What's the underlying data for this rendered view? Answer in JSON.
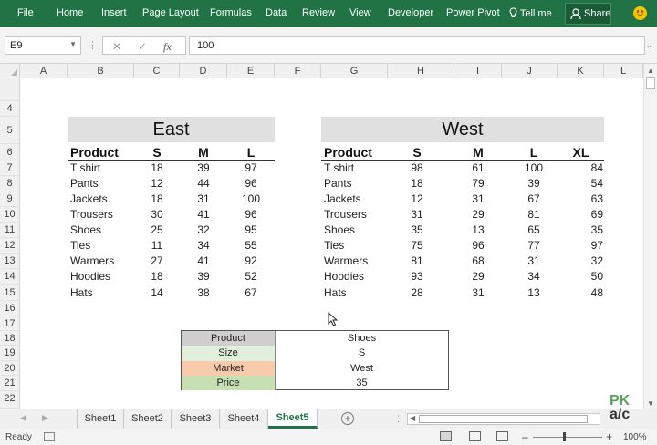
{
  "ribbon": {
    "tabs": [
      "File",
      "Home",
      "Insert",
      "Page Layout",
      "Formulas",
      "Data",
      "Review",
      "View",
      "Developer",
      "Power Pivot"
    ],
    "tell_me": "Tell me",
    "share": "Share"
  },
  "formula_bar": {
    "name_box": "E9",
    "value": "100",
    "fx": "fx"
  },
  "columns": [
    "A",
    "B",
    "C",
    "D",
    "E",
    "F",
    "G",
    "H",
    "I",
    "J",
    "K",
    "L"
  ],
  "rows": [
    "4",
    "5",
    "6",
    "7",
    "8",
    "9",
    "10",
    "11",
    "12",
    "13",
    "14",
    "15",
    "16",
    "17",
    "18",
    "19",
    "20",
    "21",
    "22"
  ],
  "east": {
    "title": "East",
    "headers": [
      "Product",
      "S",
      "M",
      "L"
    ],
    "rows": [
      [
        "T shirt",
        "18",
        "39",
        "97"
      ],
      [
        "Pants",
        "12",
        "44",
        "96"
      ],
      [
        "Jackets",
        "18",
        "31",
        "100"
      ],
      [
        "Trousers",
        "30",
        "41",
        "96"
      ],
      [
        "Shoes",
        "25",
        "32",
        "95"
      ],
      [
        "Ties",
        "11",
        "34",
        "55"
      ],
      [
        "Warmers",
        "27",
        "41",
        "92"
      ],
      [
        "Hoodies",
        "18",
        "39",
        "52"
      ],
      [
        "Hats",
        "14",
        "38",
        "67"
      ]
    ]
  },
  "west": {
    "title": "West",
    "headers": [
      "Product",
      "S",
      "M",
      "L",
      "XL"
    ],
    "rows": [
      [
        "T shirt",
        "98",
        "61",
        "100",
        "84"
      ],
      [
        "Pants",
        "18",
        "79",
        "39",
        "54"
      ],
      [
        "Jackets",
        "12",
        "31",
        "67",
        "63"
      ],
      [
        "Trousers",
        "31",
        "29",
        "81",
        "69"
      ],
      [
        "Shoes",
        "35",
        "13",
        "65",
        "35"
      ],
      [
        "Ties",
        "75",
        "96",
        "77",
        "97"
      ],
      [
        "Warmers",
        "81",
        "68",
        "31",
        "32"
      ],
      [
        "Hoodies",
        "93",
        "29",
        "34",
        "50"
      ],
      [
        "Hats",
        "28",
        "31",
        "13",
        "48"
      ]
    ]
  },
  "lookup": [
    {
      "label": "Product",
      "value": "Shoes",
      "color": "#d0cece"
    },
    {
      "label": "Size",
      "value": "S",
      "color": "#e2efda"
    },
    {
      "label": "Market",
      "value": "West",
      "color": "#f8cbad"
    },
    {
      "label": "Price",
      "value": "35",
      "color": "#c6e0b4"
    }
  ],
  "sheets": [
    "Sheet1",
    "Sheet2",
    "Sheet3",
    "Sheet4",
    "Sheet5"
  ],
  "active_sheet": "Sheet5",
  "status": {
    "ready": "Ready",
    "zoom": "100%"
  },
  "watermark": {
    "line1": "PK",
    "line2": "a/c"
  },
  "colors": {
    "ribbon": "#217346",
    "title_band": "#e0e0e0"
  }
}
